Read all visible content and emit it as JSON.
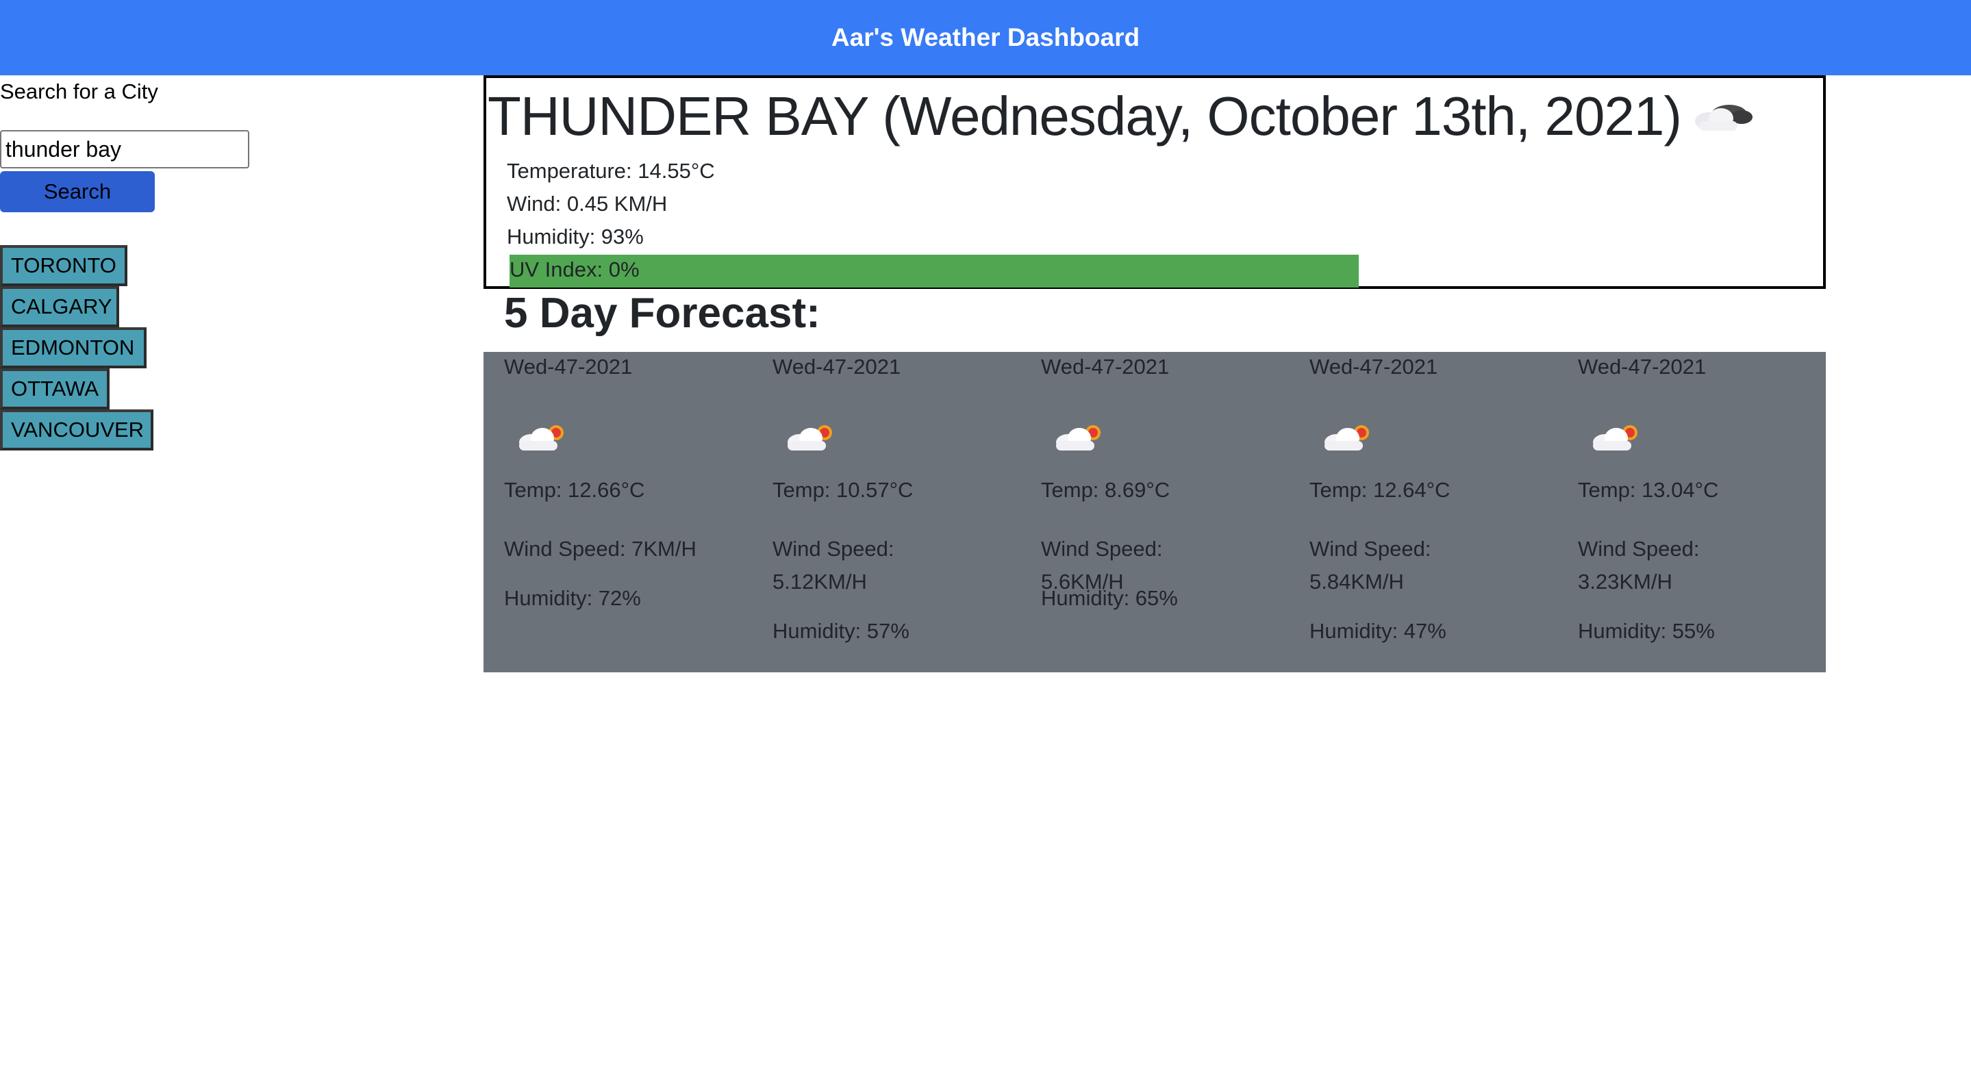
{
  "header": {
    "title": "Aar's Weather Dashboard"
  },
  "search": {
    "label": "Search for a City",
    "value": "thunder bay",
    "button_label": "Search"
  },
  "history": [
    "TORONTO",
    "CALGARY",
    "EDMONTON",
    "OTTAWA",
    "VANCOUVER"
  ],
  "current": {
    "title": "THUNDER BAY (Wednesday, October 13th, 2021)",
    "icon": "cloud-icon",
    "temperature": "Temperature: 14.55°C",
    "wind": "Wind: 0.45 KM/H",
    "humidity": "Humidity: 93%",
    "uv": "UV Index: 0%",
    "uv_color": "#51a751"
  },
  "forecast": {
    "heading": "5 Day Forecast:",
    "days": [
      {
        "date": "Wed-47-2021",
        "icon": "cloud-sun-icon",
        "temp": "Temp: 12.66°C",
        "wind": "Wind Speed: 7KM/H",
        "humidity": "Humidity: 72%"
      },
      {
        "date": "Wed-47-2021",
        "icon": "cloud-sun-icon",
        "temp": "Temp: 10.57°C",
        "wind": "Wind Speed: 5.12KM/H",
        "humidity": "Humidity: 57%"
      },
      {
        "date": "Wed-47-2021",
        "icon": "cloud-sun-icon",
        "temp": "Temp: 8.69°C",
        "wind": "Wind Speed: 5.6KM/H",
        "humidity": "Humidity: 65%"
      },
      {
        "date": "Wed-47-2021",
        "icon": "cloud-sun-icon",
        "temp": "Temp: 12.64°C",
        "wind": "Wind Speed: 5.84KM/H",
        "humidity": "Humidity: 47%"
      },
      {
        "date": "Wed-47-2021",
        "icon": "cloud-sun-icon",
        "temp": "Temp: 13.04°C",
        "wind": "Wind Speed: 3.23KM/H",
        "humidity": "Humidity: 55%"
      }
    ]
  },
  "colors": {
    "header_bg": "#377bf6",
    "search_button": "#2d5fd1",
    "history_button": "#4a9fb4",
    "forecast_bg": "#6c727a"
  }
}
